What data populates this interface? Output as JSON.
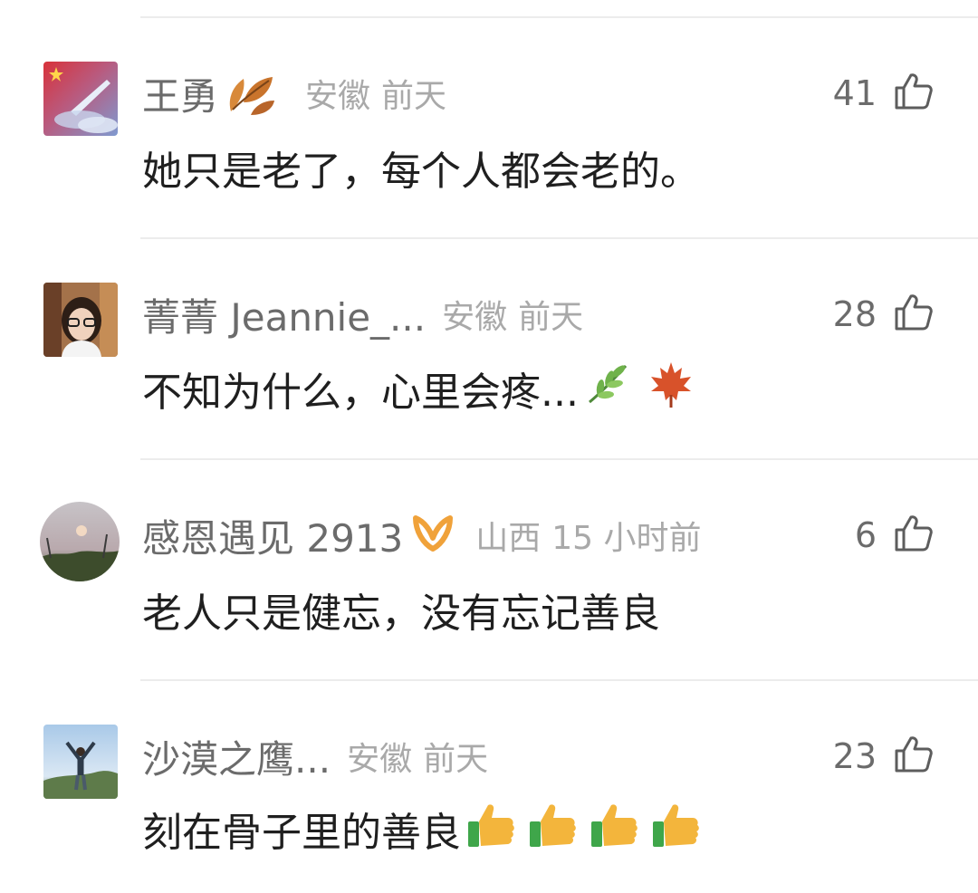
{
  "comments": [
    {
      "username": "王勇",
      "region": "安徽",
      "time": "前天",
      "likes": "41",
      "text": "她只是老了，每个人都会老的。",
      "badge_icon": "autumn-leaf-icon",
      "avatar_icon": "flag-rocket-avatar"
    },
    {
      "username": "菁菁 Jeannie_...",
      "region": "安徽",
      "time": "前天",
      "likes": "28",
      "text": "不知为什么，心里会疼...",
      "text_emojis": [
        "herb-icon",
        "maple-leaf-icon"
      ],
      "avatar_icon": "girl-portrait-avatar"
    },
    {
      "username": "感恩遇见 2913",
      "region": "山西",
      "time": "15 小时前",
      "likes": "6",
      "text": "老人只是健忘，没有忘记善良",
      "badge_icon": "orange-ribbon-icon",
      "avatar_icon": "sunset-tree-avatar"
    },
    {
      "username": "沙漠之鹰...",
      "region": "安徽",
      "time": "前天",
      "likes": "23",
      "text": "刻在骨子里的善良",
      "text_emojis": [
        "thumbs-up-icon",
        "thumbs-up-icon",
        "thumbs-up-icon",
        "thumbs-up-icon"
      ],
      "avatar_icon": "mountain-hiker-avatar"
    }
  ],
  "colors": {
    "name": "#6b6b6b",
    "meta": "#a9a9a9",
    "body": "#1f1f1f",
    "divider": "#ececec"
  }
}
